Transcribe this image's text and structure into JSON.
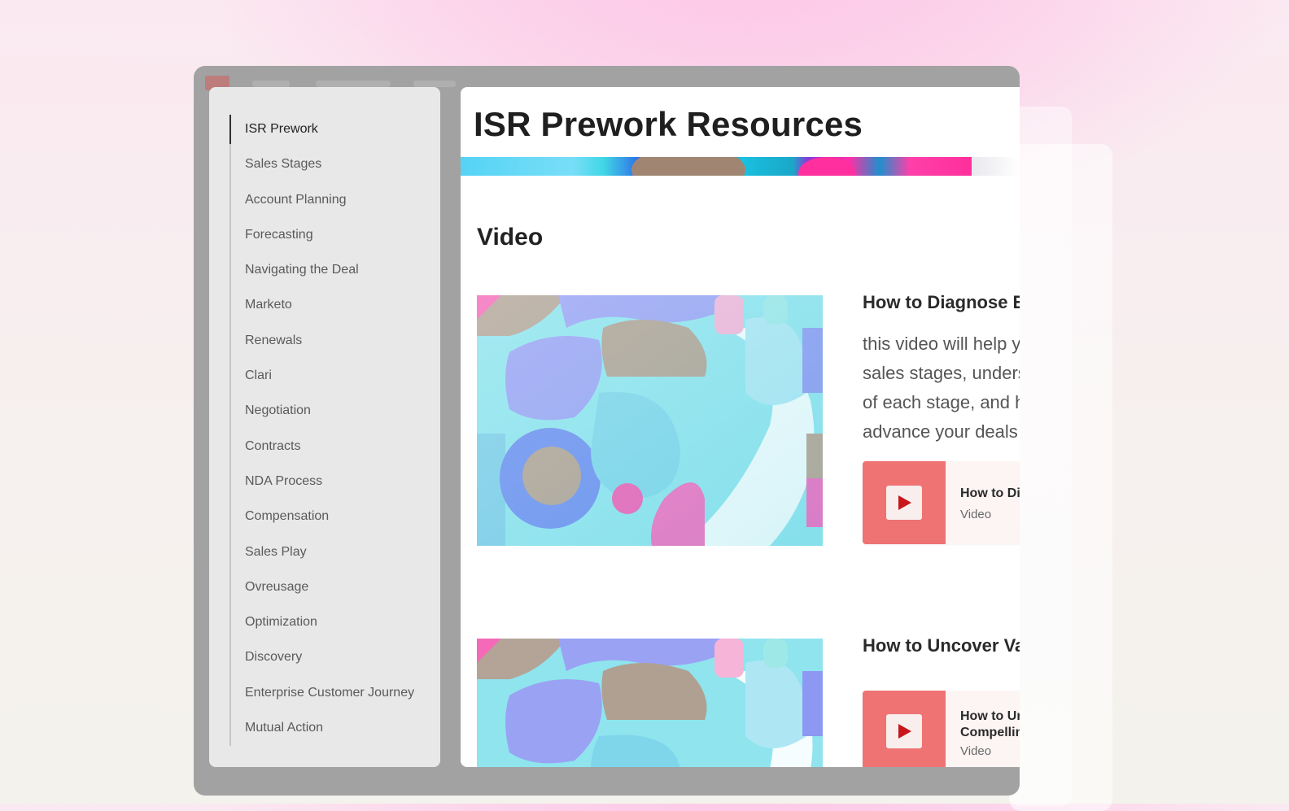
{
  "page": {
    "title": "ISR Prework Resources",
    "section_title": "Video"
  },
  "sidebar": {
    "items": [
      {
        "label": "ISR Prework",
        "active": true
      },
      {
        "label": "Sales Stages"
      },
      {
        "label": "Account Planning"
      },
      {
        "label": "Forecasting"
      },
      {
        "label": "Navigating the Deal"
      },
      {
        "label": "Marketo"
      },
      {
        "label": "Renewals"
      },
      {
        "label": "Clari"
      },
      {
        "label": "Negotiation"
      },
      {
        "label": "Contracts"
      },
      {
        "label": "NDA Process"
      },
      {
        "label": "Compensation"
      },
      {
        "label": "Sales Play"
      },
      {
        "label": "Ovreusage"
      },
      {
        "label": "Optimization"
      },
      {
        "label": "Discovery"
      },
      {
        "label": "Enterprise Customer Journey"
      },
      {
        "label": "Mutual Action"
      }
    ]
  },
  "videos": [
    {
      "title": "How to Diagnose E",
      "description": [
        "this video will help y",
        "sales stages, unders",
        "of each stage, and h",
        "advance your deals"
      ],
      "card": {
        "title": "How to Di",
        "type": "Video"
      }
    },
    {
      "title": "How to Uncover Va",
      "card": {
        "title_line1": "How to Ur",
        "title_line2": "Compellin",
        "type": "Video"
      }
    }
  ],
  "colors": {
    "accent_play_tile": "#ef7373",
    "play_icon": "#c7171b",
    "sidebar_bg": "#e8e8e8"
  },
  "icons": {
    "play": "play-icon",
    "logo": "app-logo-icon"
  }
}
